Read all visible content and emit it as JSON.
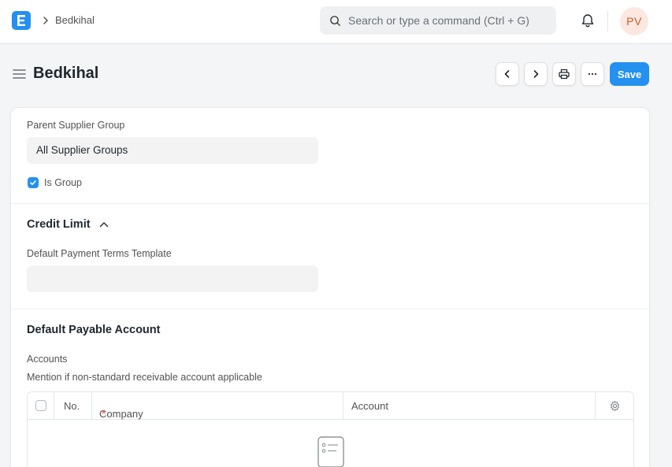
{
  "navbar": {
    "logo_letter": "E",
    "breadcrumb": "Bedkihal",
    "search_placeholder": "Search or type a command (Ctrl + G)",
    "avatar_initials": "PV"
  },
  "page": {
    "title": "Bedkihal",
    "save_label": "Save"
  },
  "form": {
    "parent_group_label": "Parent Supplier Group",
    "parent_group_value": "All Supplier Groups",
    "is_group_label": "Is Group",
    "is_group_checked": true,
    "credit_section_title": "Credit Limit",
    "payment_terms_label": "Default Payment Terms Template",
    "payment_terms_value": "",
    "payable_section_title": "Default Payable Account",
    "accounts_label": "Accounts",
    "accounts_description": "Mention if non-standard receivable account applicable",
    "accounts_table": {
      "columns": [
        "No.",
        "Company",
        "Account"
      ],
      "required_marker": "*",
      "rows": []
    }
  },
  "colors": {
    "primary": "#2490ef",
    "avatar_bg": "#fde8e1",
    "avatar_text": "#cf5a2c"
  }
}
